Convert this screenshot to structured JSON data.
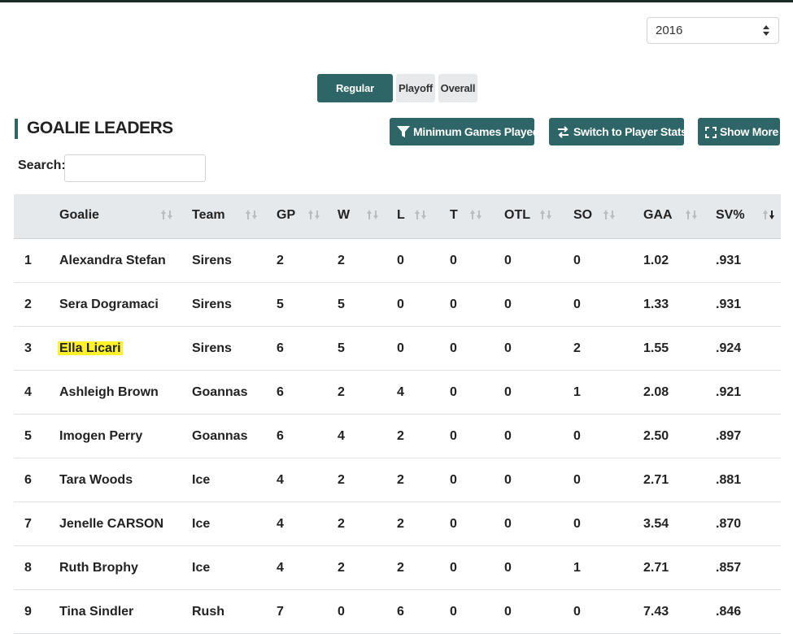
{
  "year_select": {
    "value": "2016"
  },
  "season_tabs": [
    {
      "label": "Regular Season",
      "active": true
    },
    {
      "label": "Playoff",
      "active": false
    },
    {
      "label": "Overall",
      "active": false
    }
  ],
  "heading": "GOALIE LEADERS",
  "buttons": {
    "min_games": "Minimum Games Played",
    "switch_stats": "Switch to Player Stats",
    "show_more": "Show More"
  },
  "search": {
    "label": "Search:",
    "value": "",
    "placeholder": ""
  },
  "table": {
    "columns": [
      "",
      "Goalie",
      "Team",
      "GP",
      "W",
      "L",
      "T",
      "OTL",
      "SO",
      "GAA",
      "SV%"
    ],
    "sorted_column": "SV%",
    "highlight_color": "#fff22a",
    "accent_color": "#2e6566",
    "rows": [
      [
        "1",
        "Alexandra Stefan",
        "Sirens",
        "2",
        "2",
        "0",
        "0",
        "0",
        "0",
        "1.02",
        ".931"
      ],
      [
        "2",
        "Sera Dogramaci",
        "Sirens",
        "5",
        "5",
        "0",
        "0",
        "0",
        "0",
        "1.33",
        ".931"
      ],
      [
        "3",
        "Ella Licari",
        "Sirens",
        "6",
        "5",
        "0",
        "0",
        "0",
        "2",
        "1.55",
        ".924"
      ],
      [
        "4",
        "Ashleigh Brown",
        "Goannas",
        "6",
        "2",
        "4",
        "0",
        "0",
        "1",
        "2.08",
        ".921"
      ],
      [
        "5",
        "Imogen Perry",
        "Goannas",
        "6",
        "4",
        "2",
        "0",
        "0",
        "0",
        "2.50",
        ".897"
      ],
      [
        "6",
        "Tara Woods",
        "Ice",
        "4",
        "2",
        "2",
        "0",
        "0",
        "0",
        "2.71",
        ".881"
      ],
      [
        "7",
        "Jenelle CARSON",
        "Ice",
        "4",
        "2",
        "2",
        "0",
        "0",
        "0",
        "3.54",
        ".870"
      ],
      [
        "8",
        "Ruth Brophy",
        "Ice",
        "4",
        "2",
        "2",
        "0",
        "0",
        "1",
        "2.71",
        ".857"
      ],
      [
        "9",
        "Tina Sindler",
        "Rush",
        "7",
        "0",
        "6",
        "0",
        "0",
        "0",
        "7.43",
        ".846"
      ]
    ],
    "highlighted_goalie": "Ella Licari"
  }
}
